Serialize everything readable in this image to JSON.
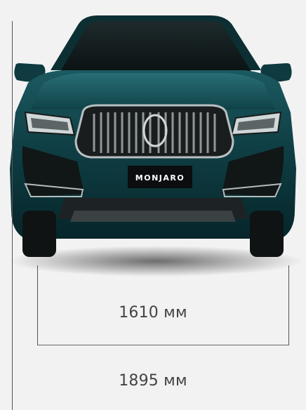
{
  "vehicle": {
    "badge": "MONJARO",
    "paint_color": "#0f3f45",
    "paint_dark": "#072327",
    "paint_highlight": "#2a6a70"
  },
  "dimensions": {
    "track_width_label": "1610 мм",
    "overall_width_label": "1895 мм"
  }
}
